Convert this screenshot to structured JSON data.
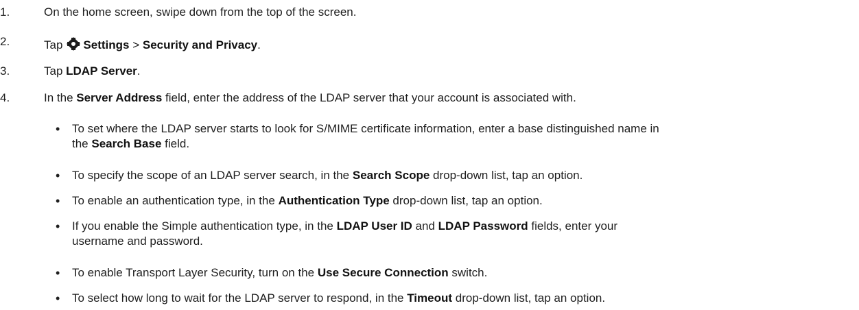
{
  "steps": [
    {
      "num": "1.",
      "text": "On the home screen, swipe down from the top of the screen."
    },
    {
      "num": "2.",
      "pre": "Tap",
      "icon": "gear-icon",
      "b1": "Settings",
      "sep": " > ",
      "b2": "Security and Privacy",
      "post": "."
    },
    {
      "num": "3.",
      "pre": "Tap ",
      "b1": "LDAP Server",
      "post": "."
    },
    {
      "num": "4.",
      "pre": "In the ",
      "b1": "Server Address",
      "post": " field, enter the address of the LDAP server that your account is associated with."
    }
  ],
  "bullets": [
    {
      "l1": "To set where the LDAP server starts to look for S/MIME certificate information, enter a base distinguished name in",
      "l2pre": "the ",
      "b1": "Search Base",
      "l2post": " field."
    },
    {
      "pre": "To specify the scope of an LDAP server search, in the ",
      "b1": "Search Scope",
      "post": " drop-down list, tap an option."
    },
    {
      "pre": "To enable an authentication type, in the ",
      "b1": "Authentication Type",
      "post": " drop-down list, tap an option."
    },
    {
      "pre": "If you enable the Simple authentication type, in the ",
      "b1": "LDAP User ID",
      "mid": " and ",
      "b2": "LDAP Password",
      "post": " fields, enter your",
      "l2": "username and password."
    },
    {
      "pre": "To enable Transport Layer Security, turn on the ",
      "b1": "Use Secure Connection",
      "post": " switch."
    },
    {
      "pre": "To select how long to wait for the LDAP server to respond, in the ",
      "b1": "Timeout",
      "post": " drop-down list, tap an option."
    }
  ],
  "bullet_glyph": "•"
}
